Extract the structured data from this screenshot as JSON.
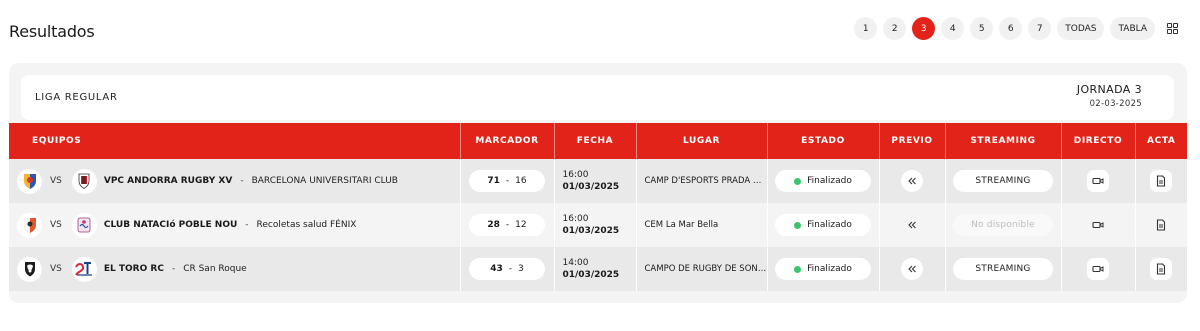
{
  "page": {
    "title": "Resultados"
  },
  "pagination": {
    "pages": [
      "1",
      "2",
      "3",
      "4",
      "5",
      "6",
      "7"
    ],
    "active": "3",
    "all_label": "TODAS",
    "table_label": "TABLA",
    "view_icon": "grid-icon"
  },
  "league": {
    "name": "LIGA REGULAR",
    "jornada": "JORNADA 3",
    "date": "02-03-2025"
  },
  "table": {
    "headers": [
      "EQUIPOS",
      "MARCADOR",
      "FECHA",
      "LUGAR",
      "ESTADO",
      "PREVIO",
      "STREAMING",
      "DIRECTO",
      "ACTA"
    ],
    "vs_label": "VS",
    "rows": [
      {
        "home": "VPC ANDORRA RUGBY XV",
        "away": "BARCELONA UNIVERSITARI CLUB",
        "score_home": "71",
        "score_away": "16",
        "time": "16:00",
        "date": "01/03/2025",
        "venue": "CAMP D'ESPORTS PRADA MOLES",
        "status": "Finalizado",
        "streaming": "STREAMING",
        "streaming_available": true
      },
      {
        "home": "CLUB NATACIó POBLE NOU",
        "away": "Recoletas salud FÉNIX",
        "score_home": "28",
        "score_away": "12",
        "time": "16:00",
        "date": "01/03/2025",
        "venue": "CEM La Mar Bella",
        "status": "Finalizado",
        "streaming": "No disponible",
        "streaming_available": false
      },
      {
        "home": "EL TORO RC",
        "away": "CR San Roque",
        "score_home": "43",
        "score_away": "3",
        "time": "14:00",
        "date": "01/03/2025",
        "venue": "CAMPO DE RUGBY DE SON MOIX",
        "status": "Finalizado",
        "streaming": "STREAMING",
        "streaming_available": true
      }
    ]
  },
  "colors": {
    "accent": "#e2231a",
    "status_ok": "#3cc46a"
  }
}
